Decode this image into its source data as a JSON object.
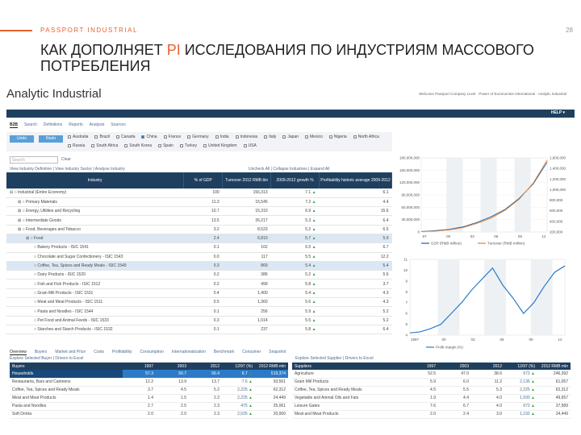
{
  "slide": {
    "header": "PASSPORT INDUSTRIAL",
    "page": "28",
    "title_a": "КАК ДОПОЛНЯЕТ ",
    "title_pi": "PI",
    "title_b": " ИССЛЕДОВАНИЯ ПО ИНДУСТРИЯМ МАССОВОГО ПОТРЕБЛЕНИЯ"
  },
  "app": {
    "brand": "Analytic Industrial",
    "welcome": "Welcome Passport Company Level · Power of Euromonitor International · Analytic Industrial",
    "help": "HELP ▾"
  },
  "nav": [
    "B2B",
    "Search",
    "Definitions",
    "Reports",
    "Analysis",
    "Sources"
  ],
  "controls": {
    "undo": "Undo",
    "redo": "Redo",
    "search_placeholder": "Search",
    "clear": "Clear",
    "links": "View Industry Definition | View Industry Sector | Analyse Industry",
    "rlinks": "Uncheck All | Collapse Industries | Expand All"
  },
  "countries": [
    "Australia",
    "Brazil",
    "Canada",
    "China",
    "France",
    "Germany",
    "India",
    "Indonesia",
    "Italy",
    "Japan",
    "Mexico",
    "Nigeria",
    "North Africa",
    "Russia",
    "South Africa",
    "South Korea",
    "Spain",
    "Turkey",
    "United Kingdom",
    "USA"
  ],
  "industry_table": {
    "headers": [
      "Industry",
      "% of GDP",
      "Turnover 2012 RMB bln",
      "2009-2012 growth %",
      "Profitability historic average 2009-2012"
    ],
    "rows": [
      {
        "name": "Industrial (Entire Economy)",
        "gdp": "100",
        "turnover": "156,313",
        "growth": "7.1",
        "profit": "6.1"
      },
      {
        "name": "Primary Materials",
        "gdp": "11.3",
        "turnover": "15,545",
        "growth": "7.2",
        "profit": "4.4"
      },
      {
        "name": "Energy, Utilities and Recycling",
        "gdp": "10.7",
        "turnover": "15,310",
        "growth": "6.9",
        "profit": "15.6"
      },
      {
        "name": "Intermediate Goods",
        "gdp": "13.5",
        "turnover": "26,217",
        "growth": "5.3",
        "profit": "6.4"
      },
      {
        "name": "Food, Beverages and Tobacco",
        "gdp": "3.2",
        "turnover": "8,523",
        "growth": "5.2",
        "profit": "6.5"
      },
      {
        "name": "Food",
        "gdp": "2.4",
        "turnover": "6,810",
        "growth": "5.7",
        "profit": "5.9"
      },
      {
        "name": "Bakery Products - ISIC 1541",
        "gdp": "0.1",
        "turnover": "162",
        "growth": "6.5",
        "profit": "6.7"
      },
      {
        "name": "Chocolate and Sugar Confectionery - ISIC 1543",
        "gdp": "0.0",
        "turnover": "117",
        "growth": "5.5",
        "profit": "12.2"
      },
      {
        "name": "Coffee, Tea, Spices and Ready Meals - ISIC 1549",
        "gdp": "0.3",
        "turnover": "869",
        "growth": "5.4",
        "profit": "5.4"
      },
      {
        "name": "Dairy Products - ISIC 1520",
        "gdp": "0.2",
        "turnover": "386",
        "growth": "5.2",
        "profit": "5.6"
      },
      {
        "name": "Fish and Fish Products - ISIC 1512",
        "gdp": "0.2",
        "turnover": "499",
        "growth": "5.8",
        "profit": "3.7"
      },
      {
        "name": "Grain Mill Products - ISIC 1531",
        "gdp": "0.4",
        "turnover": "1,400",
        "growth": "5.4",
        "profit": "4.3"
      },
      {
        "name": "Meat and Meat Products - ISIC 1511",
        "gdp": "0.5",
        "turnover": "1,360",
        "growth": "5.6",
        "profit": "4.3"
      },
      {
        "name": "Pasta and Noodles - ISIC 1544",
        "gdp": "0.1",
        "turnover": "256",
        "growth": "5.9",
        "profit": "5.2"
      },
      {
        "name": "Pet Food and Animal Feeds - ISIC 1533",
        "gdp": "0.3",
        "turnover": "1,014",
        "growth": "5.5",
        "profit": "5.2"
      },
      {
        "name": "Starches and Starch Products - ISIC 1532",
        "gdp": "0.1",
        "turnover": "237",
        "growth": "5.8",
        "profit": "6.4"
      }
    ]
  },
  "chart_data": [
    {
      "type": "line",
      "x": [
        "97",
        "00",
        "03",
        "06",
        "09",
        "12"
      ],
      "y_left_ticks": [
        "180,000,000",
        "150,000,000",
        "120,000,000",
        "90,000,000",
        "60,000,000",
        "30,000,000",
        "0"
      ],
      "y_right_ticks": [
        "1,600,000",
        "1,400,000",
        "1,200,000",
        "1,000,000",
        "800,000",
        "600,000",
        "400,000",
        "200,000"
      ],
      "series": [
        {
          "name": "GDP (RMB million)",
          "color": "#1f5fa8",
          "values": [
            1,
            3,
            6,
            12,
            22,
            35,
            52,
            77,
            110,
            160
          ]
        },
        {
          "name": "Turnover (RMB million)",
          "color": "#e8822c",
          "values": [
            1,
            2,
            5,
            10,
            20,
            32,
            50,
            75,
            112,
            165
          ]
        }
      ]
    },
    {
      "type": "line",
      "x": [
        "1997",
        "00",
        "03",
        "06",
        "09",
        "12"
      ],
      "y_ticks": [
        "11",
        "10",
        "9",
        "8",
        "7",
        "6",
        "5",
        "4"
      ],
      "series": [
        {
          "name": "Profit margin (%)",
          "color": "#2c7bc7",
          "values": [
            4.2,
            4.3,
            4.6,
            5.0,
            6.0,
            7.0,
            8.2,
            9.2,
            10.2,
            8.6,
            7.4,
            6.0,
            7.0,
            8.5,
            9.8,
            10.4
          ]
        }
      ]
    }
  ],
  "bottom": {
    "tabs": [
      "Overview",
      "Buyers",
      "Market and Price",
      "Costs",
      "Profitability",
      "Consumption",
      "Internationalization",
      "Benchmark",
      "Consumer",
      "Snapshot"
    ],
    "left_links": "Explore Selected Buyer | Drivers to Excel",
    "right_links": "Explore Selected Supplier | Drivers to Excel",
    "buyers": {
      "headers": [
        "Buyers",
        "1997",
        "2003",
        "2012",
        "12/97 (%)",
        "2012 RMB mln"
      ],
      "rows": [
        [
          "Households",
          "57.3",
          "59.7",
          "56.4",
          "6.7",
          "519,374"
        ],
        [
          "Restaurants, Bars and Canteens",
          "12.2",
          "13.9",
          "13.7",
          "7.6",
          "93,561"
        ],
        [
          "Coffee, Tea, Spices and Ready Meals",
          "3.7",
          "4.5",
          "5.2",
          "2,225",
          "62,312"
        ],
        [
          "Meat and Meat Products",
          "1.4",
          "1.5",
          "2.2",
          "2,225",
          "24,449"
        ],
        [
          "Pasta and Noodles",
          "2.7",
          "2.5",
          "2.3",
          "475",
          "25,061"
        ],
        [
          "Soft Drinks",
          "2.0",
          "2.0",
          "2.3",
          "2,025",
          "20,000"
        ]
      ]
    },
    "suppliers": {
      "headers": [
        "Suppliers",
        "1997",
        "2003",
        "2012",
        "12/97 (%)",
        "2012 RMB mln"
      ],
      "rows": [
        [
          "Agriculture",
          "52.5",
          "47.0",
          "38.6",
          "672",
          "246,392"
        ],
        [
          "Grain Mill Products",
          "5.9",
          "6.0",
          "11.2",
          "2,136",
          "61,057"
        ],
        [
          "Coffee, Tea, Spices and Ready Meals",
          "4.5",
          "5.5",
          "5.3",
          "2,225",
          "62,312"
        ],
        [
          "Vegetable and Animal Oils and Fats",
          "1.9",
          "4.4",
          "4.0",
          "1,930",
          "49,657"
        ],
        [
          "Leisure Gates",
          "7.6",
          "6.7",
          "4.0",
          "672",
          "37,589"
        ],
        [
          "Meat and Meat Products",
          "2.0",
          "2.4",
          "3.0",
          "1,192",
          "24,449"
        ]
      ]
    }
  }
}
